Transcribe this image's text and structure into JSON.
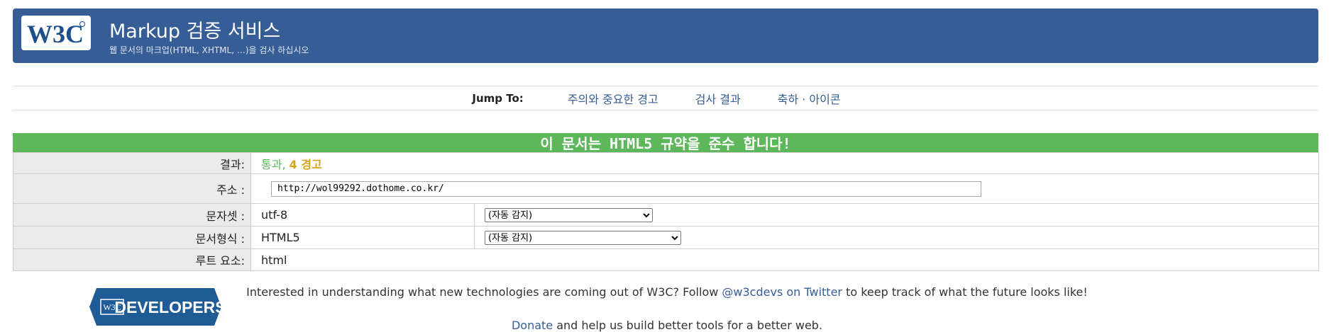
{
  "header": {
    "logo_text": "W3C",
    "title": "Markup 검증 서비스",
    "subtitle": "웹 문서의 마크업(HTML, XHTML, …)을 검사 하십시오"
  },
  "jump": {
    "label": "Jump To:",
    "links": [
      "주의와 중요한 경고",
      "검사 결과",
      "축하 · 아이콘"
    ]
  },
  "result": {
    "banner": "이 문서는 HTML5 규약을 준수 합니다!",
    "rows": {
      "result_label": "결과:",
      "result_pass": "통과,",
      "result_warn": "4 경고",
      "uri_label": "주소 :",
      "uri_value": "http://wol99292.dothome.co.kr/",
      "charset_label": "문자셋 :",
      "charset_value": "utf-8",
      "charset_select": "(자동 감지)",
      "doctype_label": "문서형식 :",
      "doctype_value": "HTML5",
      "doctype_select": "(자동 감지)",
      "root_label": "루트 요소:",
      "root_value": "html"
    }
  },
  "footer": {
    "badge_text": "DEVELOPERS",
    "badge_logo": "W3C",
    "line1_before": "Interested in understanding what new technologies are coming out of W3C? Follow ",
    "line1_link": "@w3cdevs on Twitter",
    "line1_after": " to keep track of what the future looks like!",
    "line2_link": "Donate",
    "line2_after": " and help us build better tools for a better web."
  },
  "colors": {
    "banner_blue": "#365d95",
    "pass_green": "#5eb85b",
    "warning_orange": "#d8a116"
  }
}
